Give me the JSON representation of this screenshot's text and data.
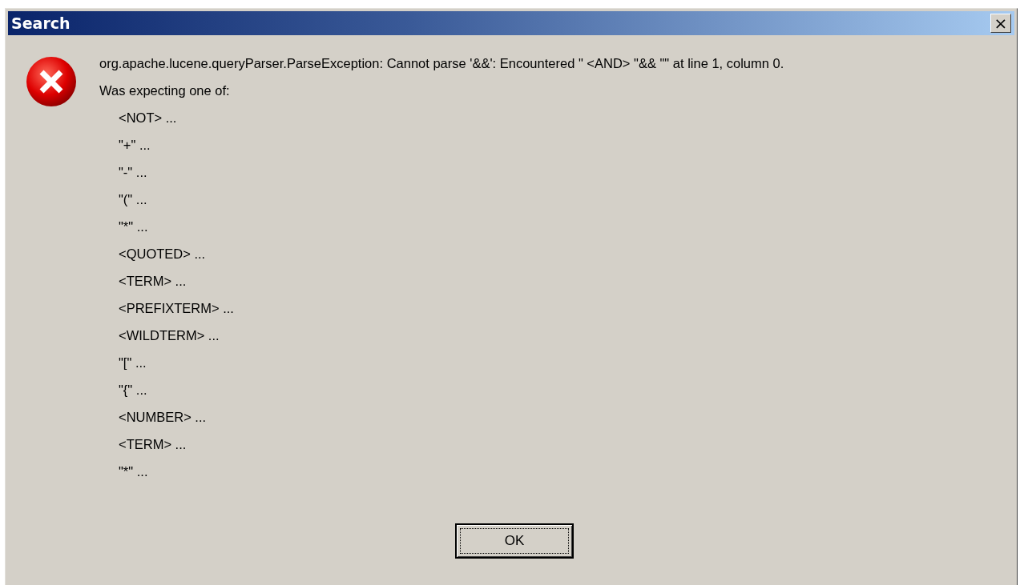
{
  "window": {
    "title": "Search",
    "close_label": "×"
  },
  "message": {
    "first_line": "org.apache.lucene.queryParser.ParseException: Cannot parse '&&': Encountered \" <AND> \"&& \"\" at line 1, column 0.",
    "second_line": "Was expecting one of:",
    "items": [
      "<NOT> ...",
      "\"+\" ...",
      "\"-\" ...",
      "\"(\" ...",
      "\"*\" ...",
      "<QUOTED> ...",
      "<TERM> ...",
      "<PREFIXTERM> ...",
      "<WILDTERM> ...",
      "\"[\" ...",
      "\"{\" ...",
      "<NUMBER> ...",
      "<TERM> ...",
      "\"*\" ..."
    ]
  },
  "buttons": [
    {
      "label": "OK",
      "focused": true
    }
  ]
}
